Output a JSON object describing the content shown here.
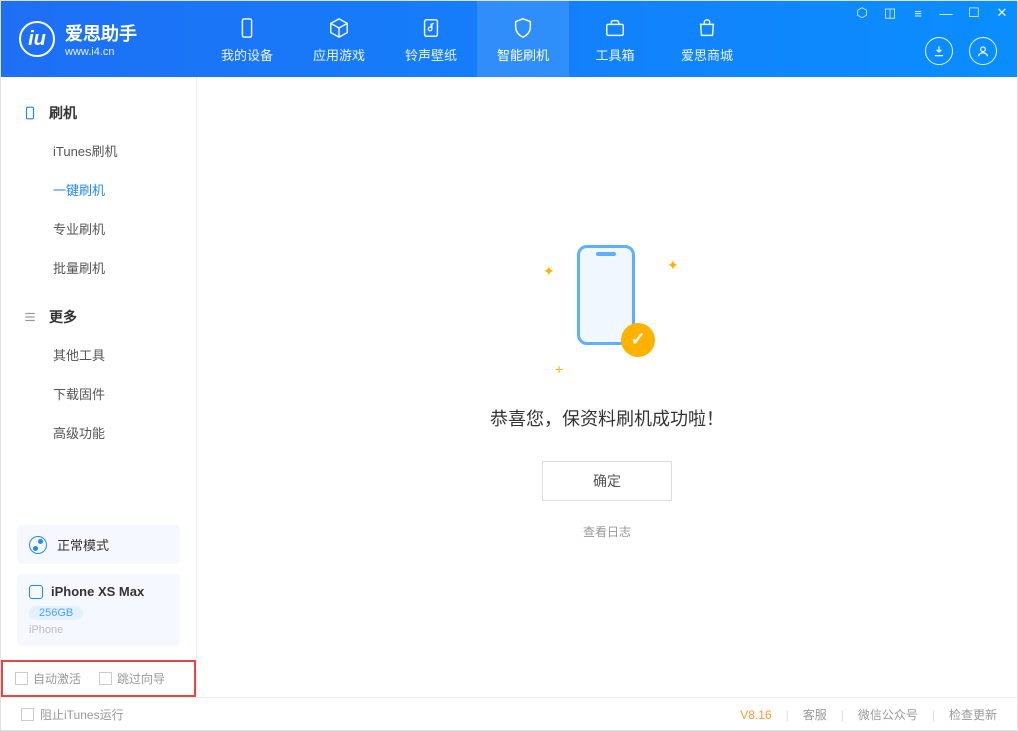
{
  "logo": {
    "title": "爱思助手",
    "subtitle": "www.i4.cn"
  },
  "nav": {
    "items": [
      {
        "label": "我的设备"
      },
      {
        "label": "应用游戏"
      },
      {
        "label": "铃声壁纸"
      },
      {
        "label": "智能刷机"
      },
      {
        "label": "工具箱"
      },
      {
        "label": "爱思商城"
      }
    ]
  },
  "sidebar": {
    "section1_title": "刷机",
    "section1_items": [
      {
        "label": "iTunes刷机"
      },
      {
        "label": "一键刷机"
      },
      {
        "label": "专业刷机"
      },
      {
        "label": "批量刷机"
      }
    ],
    "section2_title": "更多",
    "section2_items": [
      {
        "label": "其他工具"
      },
      {
        "label": "下载固件"
      },
      {
        "label": "高级功能"
      }
    ]
  },
  "device": {
    "mode": "正常模式",
    "name": "iPhone XS Max",
    "capacity": "256GB",
    "type": "iPhone"
  },
  "options": {
    "auto_activate": "自动激活",
    "skip_guide": "跳过向导"
  },
  "main": {
    "success": "恭喜您，保资料刷机成功啦！",
    "ok": "确定",
    "view_log": "查看日志"
  },
  "footer": {
    "block_itunes": "阻止iTunes运行",
    "version": "V8.16",
    "support": "客服",
    "wechat": "微信公众号",
    "update": "检查更新"
  }
}
